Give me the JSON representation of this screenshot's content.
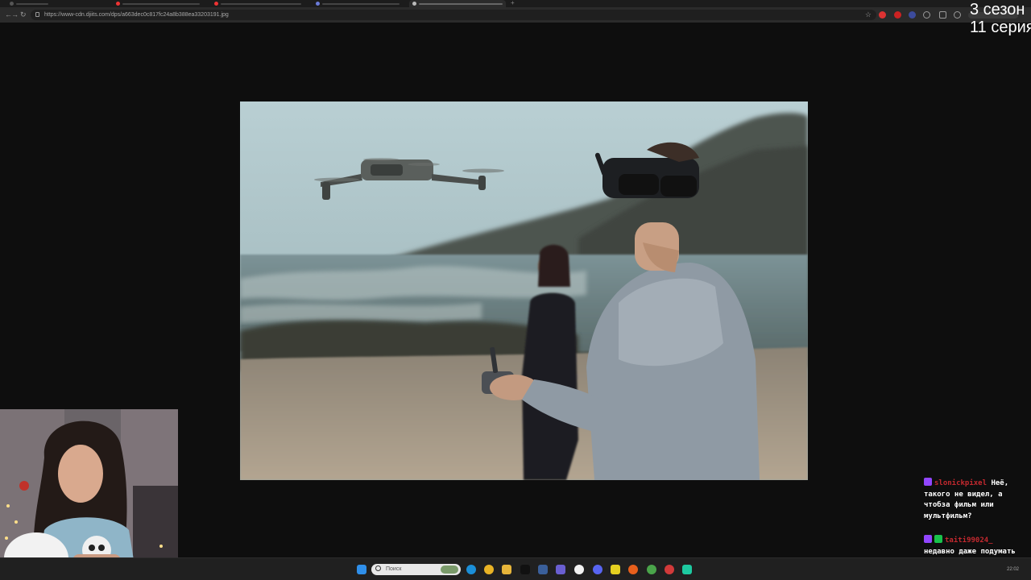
{
  "browser": {
    "url": "https://www-cdn.djiits.com/dps/a663dec0c817fc24a8b388ea33203191.jpg"
  },
  "photo": {
    "description_icon": "image-viewer"
  },
  "overlay": {
    "season_line1": "3 сезон",
    "season_line2": "11 серия"
  },
  "chat": {
    "messages": [
      {
        "username": "slonickpixel",
        "text": "Неё, такого не видел, а чтобза фильм или мультфильм?",
        "badge_color": "#9146ff"
      },
      {
        "username": "taiti99024_",
        "text": "недавно даже подумать не могли что с ТГ могут быть такие",
        "badge_color": "#9146ff"
      }
    ]
  },
  "taskbar": {
    "search_placeholder": "Поиск",
    "clock": "22:02"
  }
}
